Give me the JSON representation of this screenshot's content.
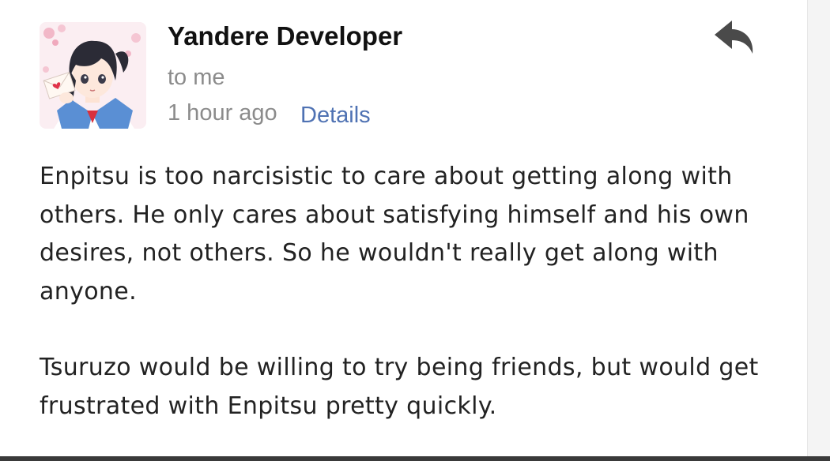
{
  "message": {
    "sender_name": "Yandere Developer",
    "recipient_line": "to me",
    "timestamp": "1 hour ago",
    "details_link": "Details",
    "body_paragraphs": [
      "Enpitsu is too narcisistic to care about getting along with others. He only cares about satisfying himself and his own desires, not others. So he wouldn't really get along with anyone.",
      "Tsuruzo would be willing to try being friends, but would get frustrated with Enpitsu pretty quickly."
    ]
  },
  "icons": {
    "avatar": "anime-schoolgirl-avatar",
    "reply": "reply-arrow-icon"
  },
  "colors": {
    "sender": "#111111",
    "meta_text": "#8b8b8b",
    "link": "#4f72b3",
    "body_text": "#222222",
    "reply_icon": "#4a4a4a"
  }
}
